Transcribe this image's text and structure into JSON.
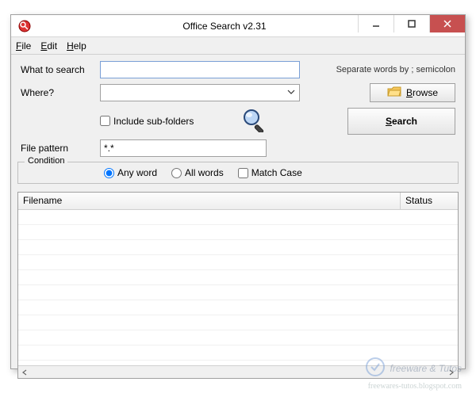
{
  "window": {
    "title": "Office Search v2.31"
  },
  "menu": {
    "file": "File",
    "edit": "Edit",
    "help": "Help"
  },
  "form": {
    "what_label": "What to search",
    "what_value": "",
    "where_label": "Where?",
    "where_value": "",
    "hint": "Separate words by ; semicolon",
    "browse": "Browse",
    "include_sub": "Include sub-folders",
    "include_sub_checked": false,
    "pattern_label": "File pattern",
    "pattern_value": "*.*",
    "search": "Search"
  },
  "condition": {
    "legend": "Condition",
    "any": "Any word",
    "all": "All words",
    "selected": "any",
    "match_case": "Match Case",
    "match_case_checked": false
  },
  "results": {
    "col_filename": "Filename",
    "col_status": "Status"
  },
  "watermark": {
    "text": "freeware & Tutos",
    "url": "freewares-tutos.blogspot.com"
  },
  "colors": {
    "accent": "#7a9fd6",
    "close": "#c75050"
  }
}
